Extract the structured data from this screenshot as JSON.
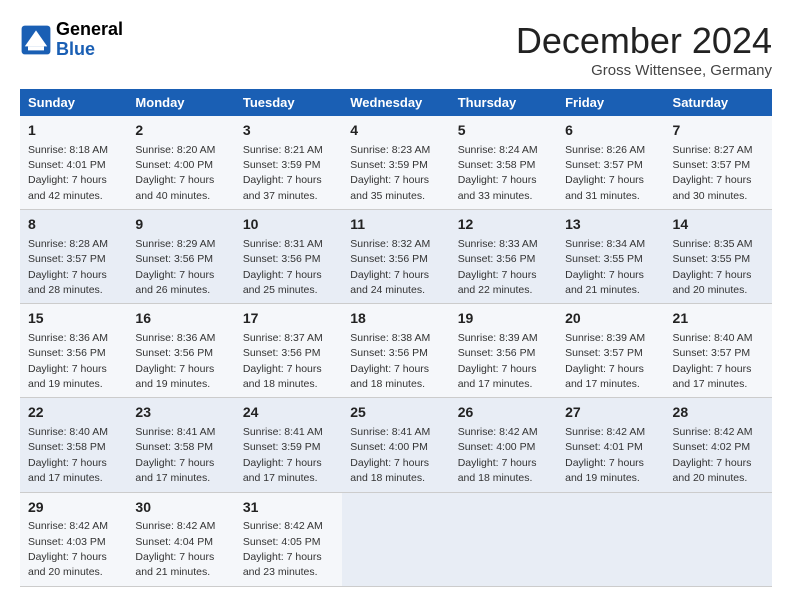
{
  "logo": {
    "text_general": "General",
    "text_blue": "Blue"
  },
  "title": "December 2024",
  "location": "Gross Wittensee, Germany",
  "days_of_week": [
    "Sunday",
    "Monday",
    "Tuesday",
    "Wednesday",
    "Thursday",
    "Friday",
    "Saturday"
  ],
  "weeks": [
    [
      {
        "day": 1,
        "sunrise": "8:18 AM",
        "sunset": "4:01 PM",
        "daylight": "7 hours and 42 minutes."
      },
      {
        "day": 2,
        "sunrise": "8:20 AM",
        "sunset": "4:00 PM",
        "daylight": "7 hours and 40 minutes."
      },
      {
        "day": 3,
        "sunrise": "8:21 AM",
        "sunset": "3:59 PM",
        "daylight": "7 hours and 37 minutes."
      },
      {
        "day": 4,
        "sunrise": "8:23 AM",
        "sunset": "3:59 PM",
        "daylight": "7 hours and 35 minutes."
      },
      {
        "day": 5,
        "sunrise": "8:24 AM",
        "sunset": "3:58 PM",
        "daylight": "7 hours and 33 minutes."
      },
      {
        "day": 6,
        "sunrise": "8:26 AM",
        "sunset": "3:57 PM",
        "daylight": "7 hours and 31 minutes."
      },
      {
        "day": 7,
        "sunrise": "8:27 AM",
        "sunset": "3:57 PM",
        "daylight": "7 hours and 30 minutes."
      }
    ],
    [
      {
        "day": 8,
        "sunrise": "8:28 AM",
        "sunset": "3:57 PM",
        "daylight": "7 hours and 28 minutes."
      },
      {
        "day": 9,
        "sunrise": "8:29 AM",
        "sunset": "3:56 PM",
        "daylight": "7 hours and 26 minutes."
      },
      {
        "day": 10,
        "sunrise": "8:31 AM",
        "sunset": "3:56 PM",
        "daylight": "7 hours and 25 minutes."
      },
      {
        "day": 11,
        "sunrise": "8:32 AM",
        "sunset": "3:56 PM",
        "daylight": "7 hours and 24 minutes."
      },
      {
        "day": 12,
        "sunrise": "8:33 AM",
        "sunset": "3:56 PM",
        "daylight": "7 hours and 22 minutes."
      },
      {
        "day": 13,
        "sunrise": "8:34 AM",
        "sunset": "3:55 PM",
        "daylight": "7 hours and 21 minutes."
      },
      {
        "day": 14,
        "sunrise": "8:35 AM",
        "sunset": "3:55 PM",
        "daylight": "7 hours and 20 minutes."
      }
    ],
    [
      {
        "day": 15,
        "sunrise": "8:36 AM",
        "sunset": "3:56 PM",
        "daylight": "7 hours and 19 minutes."
      },
      {
        "day": 16,
        "sunrise": "8:36 AM",
        "sunset": "3:56 PM",
        "daylight": "7 hours and 19 minutes."
      },
      {
        "day": 17,
        "sunrise": "8:37 AM",
        "sunset": "3:56 PM",
        "daylight": "7 hours and 18 minutes."
      },
      {
        "day": 18,
        "sunrise": "8:38 AM",
        "sunset": "3:56 PM",
        "daylight": "7 hours and 18 minutes."
      },
      {
        "day": 19,
        "sunrise": "8:39 AM",
        "sunset": "3:56 PM",
        "daylight": "7 hours and 17 minutes."
      },
      {
        "day": 20,
        "sunrise": "8:39 AM",
        "sunset": "3:57 PM",
        "daylight": "7 hours and 17 minutes."
      },
      {
        "day": 21,
        "sunrise": "8:40 AM",
        "sunset": "3:57 PM",
        "daylight": "7 hours and 17 minutes."
      }
    ],
    [
      {
        "day": 22,
        "sunrise": "8:40 AM",
        "sunset": "3:58 PM",
        "daylight": "7 hours and 17 minutes."
      },
      {
        "day": 23,
        "sunrise": "8:41 AM",
        "sunset": "3:58 PM",
        "daylight": "7 hours and 17 minutes."
      },
      {
        "day": 24,
        "sunrise": "8:41 AM",
        "sunset": "3:59 PM",
        "daylight": "7 hours and 17 minutes."
      },
      {
        "day": 25,
        "sunrise": "8:41 AM",
        "sunset": "4:00 PM",
        "daylight": "7 hours and 18 minutes."
      },
      {
        "day": 26,
        "sunrise": "8:42 AM",
        "sunset": "4:00 PM",
        "daylight": "7 hours and 18 minutes."
      },
      {
        "day": 27,
        "sunrise": "8:42 AM",
        "sunset": "4:01 PM",
        "daylight": "7 hours and 19 minutes."
      },
      {
        "day": 28,
        "sunrise": "8:42 AM",
        "sunset": "4:02 PM",
        "daylight": "7 hours and 20 minutes."
      }
    ],
    [
      {
        "day": 29,
        "sunrise": "8:42 AM",
        "sunset": "4:03 PM",
        "daylight": "7 hours and 20 minutes."
      },
      {
        "day": 30,
        "sunrise": "8:42 AM",
        "sunset": "4:04 PM",
        "daylight": "7 hours and 21 minutes."
      },
      {
        "day": 31,
        "sunrise": "8:42 AM",
        "sunset": "4:05 PM",
        "daylight": "7 hours and 23 minutes."
      },
      null,
      null,
      null,
      null
    ]
  ]
}
